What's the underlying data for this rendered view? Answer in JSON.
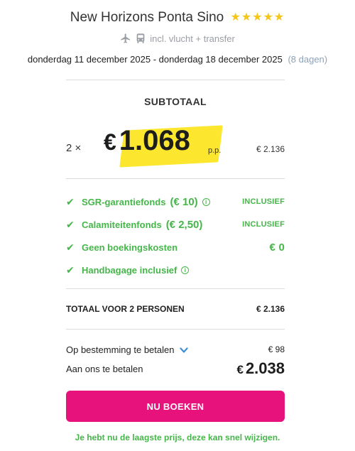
{
  "hotel": {
    "name": "New Horizons Ponta Sino",
    "stars": "★★★★★",
    "star_color": "#f5c518"
  },
  "travel": {
    "icons": [
      "plane-icon",
      "bus-icon"
    ],
    "label": "incl. vlucht + transfer"
  },
  "dates": {
    "range": "donderdag 11 december 2025 - donderdag 18 december 2025",
    "nights": "(8 dagen)"
  },
  "subtotal": {
    "label": "SUBTOTAAL",
    "quantity": "2 ×",
    "currency": "€",
    "price_per_person": "1.068",
    "pp_label": "p.p.",
    "line_total": "€ 2.136",
    "highlight_color": "#fde72e"
  },
  "inclusions": [
    {
      "icon": "check-icon",
      "label": "SGR-garantiefonds",
      "fee": "(€ 10)",
      "info": "i",
      "status": "INCLUSIEF"
    },
    {
      "icon": "check-icon",
      "label": "Calamiteitenfonds",
      "fee": "(€ 2,50)",
      "info": "",
      "status": "INCLUSIEF"
    },
    {
      "icon": "check-icon",
      "label": "Geen boekingskosten",
      "fee": "",
      "info": "",
      "status": "€ 0"
    },
    {
      "icon": "check-icon",
      "label": "Handbagage inclusief",
      "fee": "",
      "info": "i",
      "status": ""
    }
  ],
  "total": {
    "label": "TOTAAL VOOR 2 PERSONEN",
    "value": "€ 2.136"
  },
  "payment": {
    "on_site_label": "Op bestemming te betalen",
    "on_site_value": "€ 98",
    "to_us_label": "Aan ons te betalen",
    "to_us_currency": "€",
    "to_us_value": "2.038"
  },
  "book_button": {
    "label": "NU BOEKEN",
    "color": "#e8127c"
  },
  "footnote": "Je hebt nu de laagste prijs, deze kan snel wijzigen.",
  "colors": {
    "green": "#45b649",
    "link_blue": "#3d8fd6"
  }
}
